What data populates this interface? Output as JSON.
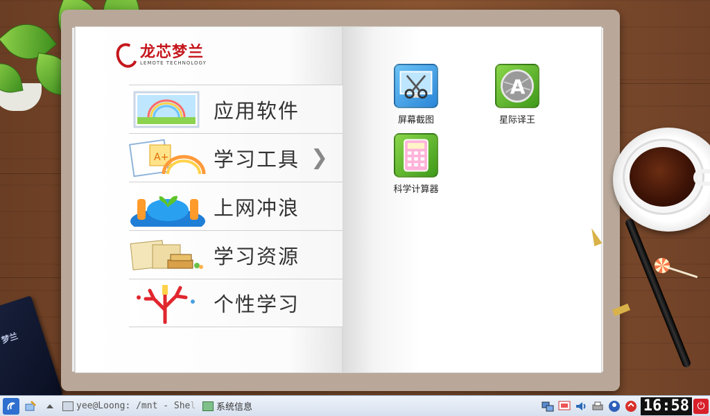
{
  "logo": {
    "cn": "龙芯梦兰",
    "en": "LEMOTE TECHNOLOGY"
  },
  "menu": {
    "items": [
      {
        "label": "应用软件",
        "icon": "window-rainbow-icon"
      },
      {
        "label": "学习工具",
        "icon": "study-tools-icon",
        "selected": true,
        "arrow": "❯"
      },
      {
        "label": "上网冲浪",
        "icon": "globe-people-icon"
      },
      {
        "label": "学习资源",
        "icon": "books-icon"
      },
      {
        "label": "个性学习",
        "icon": "coral-tree-icon"
      }
    ]
  },
  "apps": [
    {
      "label": "屏幕截图",
      "icon": "screenshot-scissors-icon",
      "color": "#3c9be0"
    },
    {
      "label": "星际译王",
      "icon": "stardict-a-icon",
      "color": "#5fb32a"
    },
    {
      "label": "科学计算器",
      "icon": "calculator-icon",
      "color": "#5fb32a"
    }
  ],
  "notebook": {
    "text": "梦兰"
  },
  "taskbar": {
    "tasks": [
      {
        "label": "yee@Loong: /mnt - She",
        "fade": "l"
      },
      {
        "label": "系统信息"
      }
    ],
    "clock": "16:58",
    "power": "⏻"
  },
  "colors": {
    "brand_red": "#c4161c",
    "desk": "#7f4c2c",
    "taskbar": "#dde6f2"
  }
}
